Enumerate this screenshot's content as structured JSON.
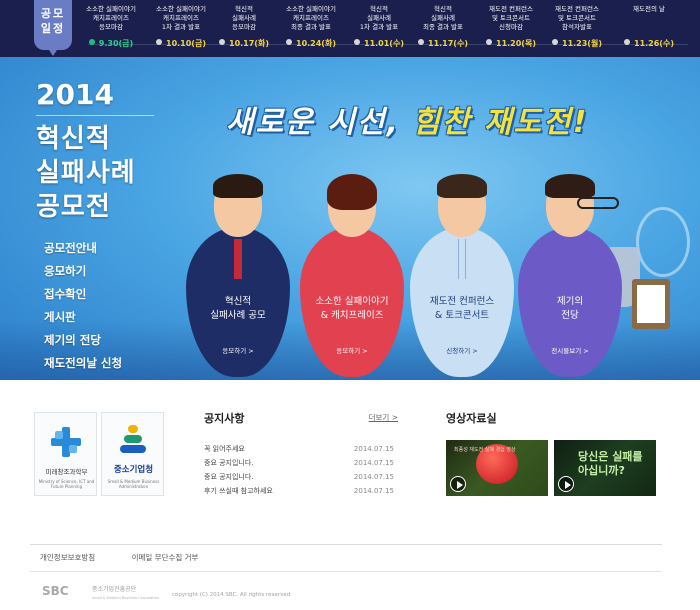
{
  "timeline": {
    "badge": "공모\n일정",
    "items": [
      {
        "label": "소소한 실패이야기\n캐치프레이즈\n응모마감",
        "date": "9.30(금)",
        "active": true
      },
      {
        "label": "소소한 실패이야기\n캐치프레이즈\n1차 결과 발표",
        "date": "10.10(금)",
        "active": false
      },
      {
        "label": "혁신적\n실패사례\n응모마감",
        "date": "10.17(화)",
        "active": false
      },
      {
        "label": "소소한 실패이야기\n캐치프레이즈\n최종 결과 발표",
        "date": "10.24(화)",
        "active": false
      },
      {
        "label": "혁신적\n실패사례\n1차 결과 발표",
        "date": "11.01(수)",
        "active": false
      },
      {
        "label": "혁신적\n실패사례\n최종 결과 발표",
        "date": "11.17(수)",
        "active": false
      },
      {
        "label": "재도전 컨퍼런스\n및 토크콘서트\n신청마감",
        "date": "11.20(목)",
        "active": false
      },
      {
        "label": "재도전 컨퍼런스\n및 토크콘서트\n참석자발표",
        "date": "11.23(월)",
        "active": false
      },
      {
        "label": "재도전의 날",
        "date": "11.26(수)",
        "active": false
      }
    ]
  },
  "hero": {
    "year": "2014",
    "title_lines": [
      "혁신적",
      "실패사례",
      "공모전"
    ],
    "slogan_pre": "새로운 시선, ",
    "slogan_highlight": "힘찬 재도전!",
    "menu": [
      "공모전안내",
      "응모하기",
      "접수확인",
      "게시판",
      "제기의 전당",
      "재도전의날 신청"
    ],
    "dolls": [
      {
        "label": "혁신적\n실패사례 공모",
        "sub": "응모하기 >"
      },
      {
        "label": "소소한 실패이야기\n& 캐치프레이즈",
        "sub": "응모하기 >"
      },
      {
        "label": "재도전 컨퍼런스\n& 토크콘서트",
        "sub": "신청하기 >"
      },
      {
        "label": "제기의\n전당",
        "sub": "전시물보기 >"
      }
    ]
  },
  "logos": {
    "msip": {
      "name": "미래창조과학부",
      "sub": "Ministry of Science, ICT and\nFuture Planning"
    },
    "smba": {
      "name": "중소기업청",
      "sub": "Small & Medium Business\nAdministration"
    }
  },
  "notice": {
    "title": "공지사항",
    "more": "더보기 >",
    "items": [
      {
        "title": "꼭 읽어주세요",
        "date": "2014.07.15"
      },
      {
        "title": "중요 공지입니다.",
        "date": "2014.07.15"
      },
      {
        "title": "중요 공지입니다.",
        "date": "2014.07.15"
      },
      {
        "title": "후기 쓰실때 참고하세요",
        "date": "2014.07.15"
      }
    ]
  },
  "video": {
    "title": "영상자료실",
    "thumbs": [
      {
        "caption": "최종성 재도전 실패 경험 영상"
      },
      {
        "caption": "당신은 실패를\n아십니까?"
      }
    ]
  },
  "footer": {
    "links": [
      "개인정보보호방침",
      "이메일 무단수집 거부"
    ],
    "logo": "SBC",
    "org_name": "중소기업진흥공단",
    "org_sub": "Small & Medium Business Corporation",
    "copyright": "copyright (C) 2014 SBC. All rights reserved"
  },
  "colors": {
    "timeline_bg": "#1b1f4e",
    "badge": "#6a7cc4",
    "date_yellow": "#f3d33d",
    "active_green": "#17c27a",
    "hero_blue": "#4aa5e3"
  }
}
